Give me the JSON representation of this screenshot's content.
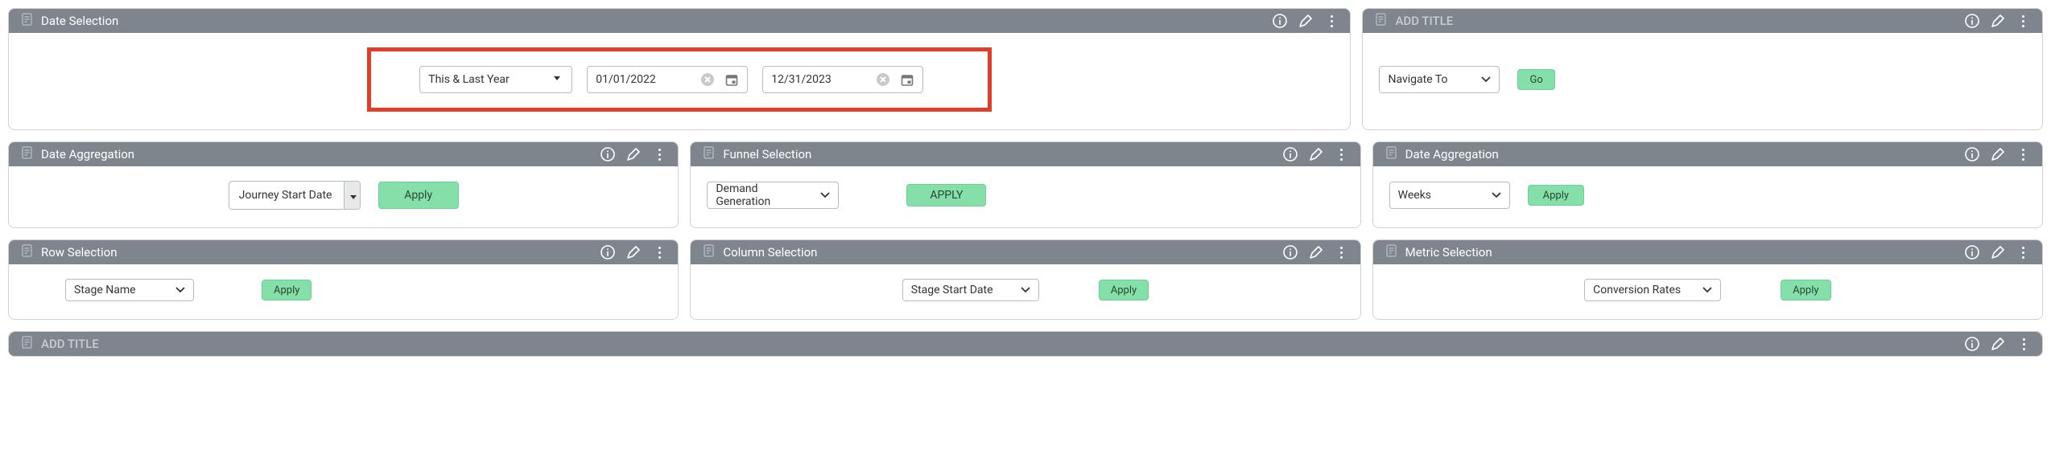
{
  "date_selection": {
    "title": "Date Selection",
    "range_preset": "This & Last Year",
    "start_date": "01/01/2022",
    "end_date": "12/31/2023"
  },
  "nav_panel": {
    "title": "ADD TITLE",
    "select_value": "Navigate To",
    "go_label": "Go"
  },
  "date_agg_1": {
    "title": "Date Aggregation",
    "select_value": "Journey Start Date",
    "apply_label": "Apply"
  },
  "funnel": {
    "title": "Funnel Selection",
    "select_value": "Demand Generation",
    "apply_label": "APPLY"
  },
  "date_agg_2": {
    "title": "Date Aggregation",
    "select_value": "Weeks",
    "apply_label": "Apply"
  },
  "row_sel": {
    "title": "Row Selection",
    "select_value": "Stage Name",
    "apply_label": "Apply"
  },
  "col_sel": {
    "title": "Column Selection",
    "select_value": "Stage Start Date",
    "apply_label": "Apply"
  },
  "metric_sel": {
    "title": "Metric Selection",
    "select_value": "Conversion Rates",
    "apply_label": "Apply"
  },
  "footer": {
    "title": "ADD TITLE"
  }
}
